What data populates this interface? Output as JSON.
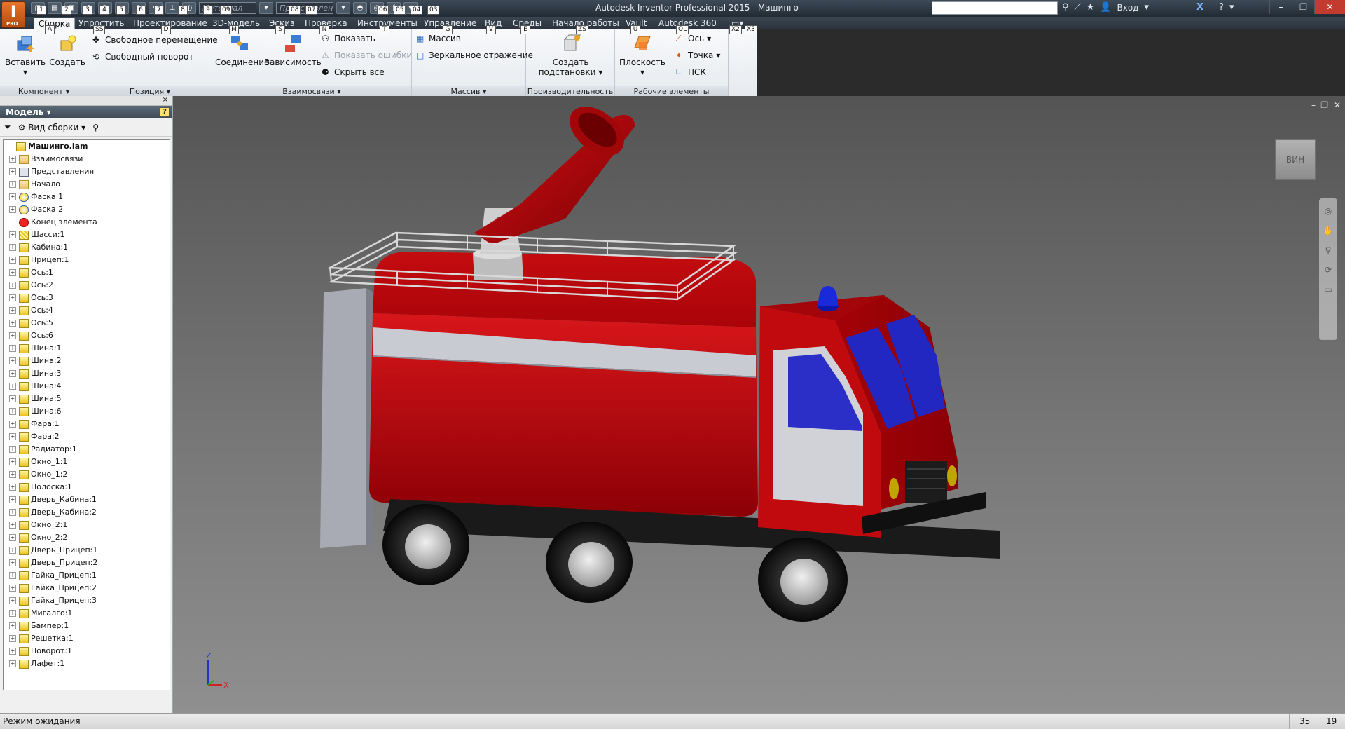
{
  "app": {
    "title": "Autodesk Inventor Professional 2015",
    "document": "Машинго",
    "logo_letter": "I",
    "logo_badge": "PRO"
  },
  "quick_access": {
    "material_placeholder": "Материал",
    "appearance_placeholder": "Представлен",
    "login": "Вход"
  },
  "menu_tabs": [
    {
      "label": "Сборка",
      "active": true
    },
    {
      "label": "Упростить"
    },
    {
      "label": "Проектирование"
    },
    {
      "label": "3D-модель"
    },
    {
      "label": "Эскиз"
    },
    {
      "label": "Проверка"
    },
    {
      "label": "Инструменты"
    },
    {
      "label": "Управление"
    },
    {
      "label": "Вид"
    },
    {
      "label": "Среды"
    },
    {
      "label": "Начало работы"
    },
    {
      "label": "Vault"
    },
    {
      "label": "Autodesk 360"
    }
  ],
  "keytips": [
    "A",
    "SS",
    "D",
    "M",
    "S",
    "N",
    "T",
    "G",
    "V",
    "E",
    "ZS",
    "U",
    "OL",
    "X2",
    "X3",
    "1",
    "2",
    "3",
    "4",
    "5",
    "6",
    "7",
    "8",
    "9",
    "09",
    "08",
    "07",
    "06",
    "05",
    "04",
    "03"
  ],
  "ribbon": {
    "component_panel": {
      "title": "Компонент",
      "insert": "Вставить",
      "create": "Создать"
    },
    "position_panel": {
      "title": "Позиция",
      "free_move": "Свободное перемещение",
      "free_rotate": "Свободный поворот"
    },
    "relations_panel": {
      "title": "Взаимосвязи",
      "joint": "Соединение",
      "constraint": "Зависимость",
      "show": "Показать",
      "show_errors": "Показать ошибки",
      "hide_all": "Скрыть все"
    },
    "pattern_panel": {
      "title": "Массив",
      "pattern": "Массив",
      "mirror": "Зеркальное отражение"
    },
    "productivity_panel": {
      "title": "Производительность",
      "create_sub_1": "Создать",
      "create_sub_2": "подстановки"
    },
    "workfeatures_panel": {
      "title": "Рабочие элементы",
      "plane": "Плоскость",
      "axis": "Ось",
      "point": "Точка",
      "ucs": "ПСК"
    }
  },
  "model_pane": {
    "header": "Модель",
    "close": "×",
    "help": "?",
    "view_label": "Вид сборки",
    "tree": [
      {
        "label": "Машинго.iam",
        "icon": "assembly",
        "root": true
      },
      {
        "label": "Взаимосвязи",
        "icon": "folder"
      },
      {
        "label": "Представления",
        "icon": "rep"
      },
      {
        "label": "Начало",
        "icon": "folder"
      },
      {
        "label": "Фаска 1",
        "icon": "fx"
      },
      {
        "label": "Фаска 2",
        "icon": "fx"
      },
      {
        "label": "Конец элемента",
        "icon": "end"
      },
      {
        "label": "Шасси:1",
        "icon": "chassis"
      },
      {
        "label": "Кабина:1",
        "icon": "part"
      },
      {
        "label": "Прицеп:1",
        "icon": "part"
      },
      {
        "label": "Ось:1",
        "icon": "part"
      },
      {
        "label": "Ось:2",
        "icon": "part"
      },
      {
        "label": "Ось:3",
        "icon": "part"
      },
      {
        "label": "Ось:4",
        "icon": "part"
      },
      {
        "label": "Ось:5",
        "icon": "part"
      },
      {
        "label": "Ось:6",
        "icon": "part"
      },
      {
        "label": "Шина:1",
        "icon": "part"
      },
      {
        "label": "Шина:2",
        "icon": "part"
      },
      {
        "label": "Шина:3",
        "icon": "part"
      },
      {
        "label": "Шина:4",
        "icon": "part"
      },
      {
        "label": "Шина:5",
        "icon": "part"
      },
      {
        "label": "Шина:6",
        "icon": "part"
      },
      {
        "label": "Фара:1",
        "icon": "part"
      },
      {
        "label": "Фара:2",
        "icon": "part"
      },
      {
        "label": "Радиатор:1",
        "icon": "part"
      },
      {
        "label": "Окно_1:1",
        "icon": "part"
      },
      {
        "label": "Окно_1:2",
        "icon": "part"
      },
      {
        "label": "Полоска:1",
        "icon": "part"
      },
      {
        "label": "Дверь_Кабина:1",
        "icon": "part"
      },
      {
        "label": "Дверь_Кабина:2",
        "icon": "part"
      },
      {
        "label": "Окно_2:1",
        "icon": "part"
      },
      {
        "label": "Окно_2:2",
        "icon": "part"
      },
      {
        "label": "Дверь_Прицеп:1",
        "icon": "part"
      },
      {
        "label": "Дверь_Прицеп:2",
        "icon": "part"
      },
      {
        "label": "Гайка_Прицеп:1",
        "icon": "part"
      },
      {
        "label": "Гайка_Прицеп:2",
        "icon": "part"
      },
      {
        "label": "Гайка_Прицеп:3",
        "icon": "part"
      },
      {
        "label": "Мигалго:1",
        "icon": "part"
      },
      {
        "label": "Бампер:1",
        "icon": "part"
      },
      {
        "label": "Решетка:1",
        "icon": "part"
      },
      {
        "label": "Поворот:1",
        "icon": "part"
      },
      {
        "label": "Лафет:1",
        "icon": "part"
      }
    ]
  },
  "viewport": {
    "viewcube_label": "ВИН",
    "axis_z": "Z",
    "axis_x": "X",
    "colors": {
      "body": "#b0060a",
      "stripe": "#c8c9d0",
      "window": "#2a2ccf",
      "beacon": "#1a2adb",
      "tire": "#1b1b1b",
      "rim": "#d6d6d6"
    }
  },
  "status": {
    "text": "Режим ожидания",
    "count1": "35",
    "count2": "19"
  }
}
